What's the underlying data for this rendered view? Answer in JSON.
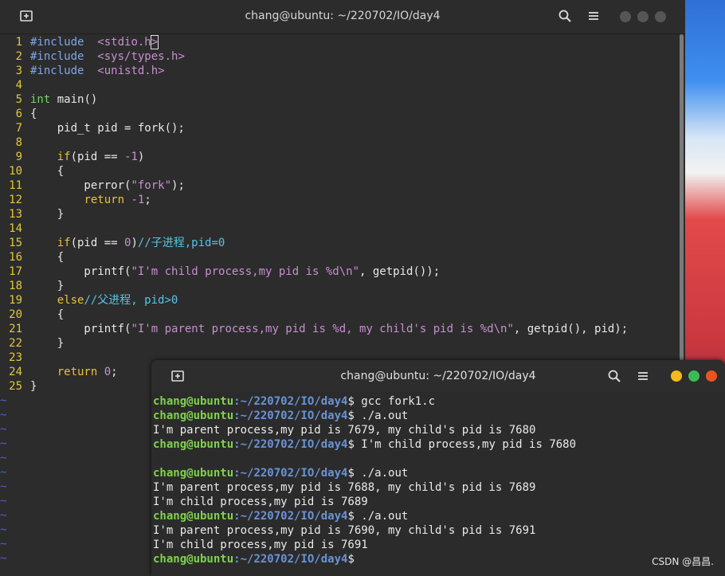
{
  "editor_window": {
    "title": "chang@ubuntu: ~/220702/IO/day4",
    "code": [
      {
        "n": "1",
        "parts": [
          [
            "pp",
            "#include"
          ],
          [
            "",
            "  "
          ],
          [
            "inc",
            "<stdio.h"
          ],
          [
            "cur",
            ">"
          ]
        ]
      },
      {
        "n": "2",
        "parts": [
          [
            "pp",
            "#include"
          ],
          [
            "",
            "  "
          ],
          [
            "inc",
            "<sys/types.h>"
          ]
        ]
      },
      {
        "n": "3",
        "parts": [
          [
            "pp",
            "#include"
          ],
          [
            "",
            "  "
          ],
          [
            "inc",
            "<unistd.h>"
          ]
        ]
      },
      {
        "n": "4",
        "parts": []
      },
      {
        "n": "5",
        "parts": [
          [
            "ty",
            "int"
          ],
          [
            "",
            " main()"
          ]
        ]
      },
      {
        "n": "6",
        "parts": [
          [
            "",
            "{"
          ]
        ]
      },
      {
        "n": "7",
        "parts": [
          [
            "",
            "    pid_t pid = fork();"
          ]
        ]
      },
      {
        "n": "8",
        "parts": []
      },
      {
        "n": "9",
        "parts": [
          [
            "",
            "    "
          ],
          [
            "kw",
            "if"
          ],
          [
            "",
            "(pid == "
          ],
          [
            "num",
            "-1"
          ],
          [
            "",
            ")"
          ]
        ]
      },
      {
        "n": "10",
        "parts": [
          [
            "",
            "    {"
          ]
        ]
      },
      {
        "n": "11",
        "parts": [
          [
            "",
            "        perror("
          ],
          [
            "str",
            "\"fork\""
          ],
          [
            "",
            ");"
          ]
        ]
      },
      {
        "n": "12",
        "parts": [
          [
            "",
            "        "
          ],
          [
            "kw",
            "return"
          ],
          [
            "",
            " "
          ],
          [
            "num",
            "-1"
          ],
          [
            "",
            ";"
          ]
        ]
      },
      {
        "n": "13",
        "parts": [
          [
            "",
            "    }"
          ]
        ]
      },
      {
        "n": "14",
        "parts": []
      },
      {
        "n": "15",
        "parts": [
          [
            "",
            "    "
          ],
          [
            "kw",
            "if"
          ],
          [
            "",
            "(pid == "
          ],
          [
            "num",
            "0"
          ],
          [
            "",
            ")"
          ],
          [
            "cm",
            "//子进程,pid=0"
          ]
        ]
      },
      {
        "n": "16",
        "parts": [
          [
            "",
            "    {"
          ]
        ]
      },
      {
        "n": "17",
        "parts": [
          [
            "",
            "        printf("
          ],
          [
            "str",
            "\"I'm child process,my pid is %d\\n\""
          ],
          [
            "",
            ", getpid());"
          ]
        ]
      },
      {
        "n": "18",
        "parts": [
          [
            "",
            "    }"
          ]
        ]
      },
      {
        "n": "19",
        "parts": [
          [
            "",
            "    "
          ],
          [
            "kw",
            "else"
          ],
          [
            "cm",
            "//父进程, pid>0"
          ]
        ]
      },
      {
        "n": "20",
        "parts": [
          [
            "",
            "    {"
          ]
        ]
      },
      {
        "n": "21",
        "parts": [
          [
            "",
            "        printf("
          ],
          [
            "str",
            "\"I'm parent process,my pid is %d, my child's pid is %d\\n\""
          ],
          [
            "",
            ", getpid(), pid);"
          ]
        ]
      },
      {
        "n": "22",
        "parts": [
          [
            "",
            "    }"
          ]
        ]
      },
      {
        "n": "23",
        "parts": []
      },
      {
        "n": "24",
        "parts": [
          [
            "",
            "    "
          ],
          [
            "kw",
            "return"
          ],
          [
            "",
            " "
          ],
          [
            "num",
            "0"
          ],
          [
            "",
            ";"
          ]
        ]
      },
      {
        "n": "25",
        "parts": [
          [
            "",
            "}"
          ]
        ]
      }
    ],
    "tilde": "~",
    "tilde_count": 12
  },
  "terminal_window": {
    "title": "chang@ubuntu: ~/220702/IO/day4",
    "prompt_user": "chang@ubuntu",
    "prompt_path": ":~/220702/IO/day4",
    "lines": [
      {
        "prompt": true,
        "cmd": "$ gcc fork1.c"
      },
      {
        "prompt": true,
        "cmd": "$ ./a.out"
      },
      {
        "prompt": false,
        "text": "I'm parent process,my pid is 7679, my child's pid is 7680"
      },
      {
        "prompt": true,
        "cmd": "$ I'm child process,my pid is 7680"
      },
      {
        "prompt": false,
        "text": ""
      },
      {
        "prompt": true,
        "cmd": "$ ./a.out"
      },
      {
        "prompt": false,
        "text": "I'm parent process,my pid is 7688, my child's pid is 7689"
      },
      {
        "prompt": false,
        "text": "I'm child process,my pid is 7689"
      },
      {
        "prompt": true,
        "cmd": "$ ./a.out"
      },
      {
        "prompt": false,
        "text": "I'm parent process,my pid is 7690, my child's pid is 7691"
      },
      {
        "prompt": false,
        "text": "I'm child process,my pid is 7691"
      },
      {
        "prompt": true,
        "cmd": "$"
      }
    ]
  },
  "watermark": "CSDN @昌昌.",
  "colors": {
    "traffic_close": "#e95420",
    "traffic_min": "#f4b91e",
    "traffic_max": "#3cba54",
    "inactive_dot": "#555555"
  },
  "icons": {
    "new_tab": "new-tab-icon",
    "search": "search-icon",
    "menu": "hamburger-menu-icon"
  }
}
